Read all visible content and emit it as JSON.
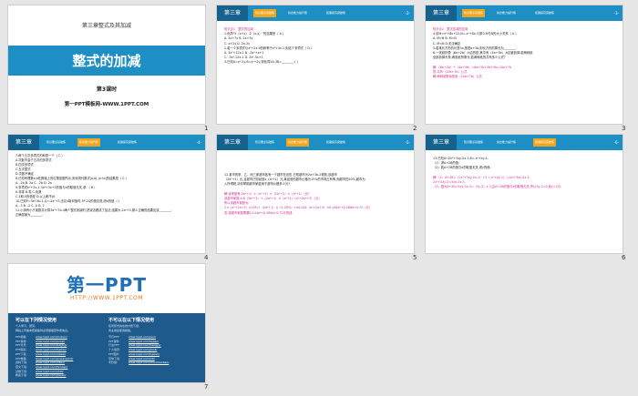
{
  "slides": [
    {
      "number": "1",
      "chapter": "第三章整式及其加减",
      "title": "整式的加减",
      "lesson": "第3课时",
      "site": "第一PPT模板网-WWW.1PPT.COM"
    },
    {
      "number": "2",
      "tag": "第三章",
      "tabs": [
        "知识要点基础练",
        "综合能力提升练",
        "拓展探究突破练"
      ],
      "active_tab": 0,
      "page": "-2-",
      "lines": [
        "知识点1　整式的加减",
        "1.化简\"5（x+y）-2（x-y）\"的结果是（ A ）",
        "A. 3x+7y  B. 2x+3y",
        "C. x+2y  D. 2x-2y",
        "2.若一个多项式与x²+2x-9的和等于x²+4x-1,则这个多项式（ D ）",
        "A. 3x²+12x-1  B. -3x²+x+1",
        "C. -3x²-12x-1  D. 2x²-5x+1",
        "3.已知A=x²-2y,B=y²+2y,则化简2A-3B=________.( )"
      ]
    },
    {
      "number": "3",
      "tag": "第三章",
      "tabs": [
        "知识要点基础练",
        "综合能力提升练",
        "拓展探究突破练"
      ],
      "active_tab": 0,
      "page": "-3-",
      "lines": [
        "知识点2　整式加减的应用",
        "4.设M=x²+8x+12,N=-x²+8x-3,那么M与N的大小关系（ A ）",
        "A. M>N  B. M=N",
        "C. M<N  D.无法确定",
        "5.若某长方形的长是3a,宽是a+2b,则长方形的周长为________.",
        "6.一张纸折叠（6a+2b）,b边的是,其中有（4a+5b）,b边被剪掉,若两种纸",
        "全部剪掉长条,两张纸所剩长,若两种纸的共有多少公式?",
        "",
        "解:（6a+2b）+（4a+5b）=6a+2b+4a+5b=10a+7b",
        "答:共有（10a+7b）公式.",
        "解:两种纸剩余的纸（10a+7b）公式."
      ]
    },
    {
      "number": "4",
      "tag": "第三章",
      "tabs": [
        "知识要点基础练",
        "综合能力提升练",
        "拓展探究突破练"
      ],
      "active_tab": 1,
      "page": "-4-",
      "lines": [
        "7.两个五次多项式的和是一个（ C ）",
        "A.次数不高于五次的多项式",
        "B.四次多项式",
        "C.五次整式",
        "D.次数不确定",
        "8.已知有理数a,b在数轴上的位置如图所示,则化简代数式|a-b|-|a+b|的结果是（ C ）",
        "A. -2b  B. 2a  C. -2b  D. 2a",
        "9.多项式x²+2x-1-3x²+3x+2的值与x的取值无关,求-（ B ）",
        "A.非零  B.零  C.负数",
        "C.2和-5的值是 D.以上都不对",
        "10.已知P=3a²-5b-1,Q=-2a²+3,无论x取何值时,3P-2Q的值总是,则a的值（ ）",
        "A. -3  B. -2  C. 0  D. 2",
        "11.小淇有小于某数并计算3a²+7b-4两个整式相减时,把减法看成了加法,结果为-2a²+5,那么正确的结果应该________.",
        "正确答案为________."
      ]
    },
    {
      "number": "5",
      "tag": "第三章",
      "tabs": [
        "知识要点基础练",
        "综合能力提升练",
        "拓展探究突破练"
      ],
      "active_tab": 1,
      "page": "-5-",
      "lines": [
        "12.某市的甲、乙、丙三家超市各有一个超市在出售,已知超市为2a+3b-2得到,该超市",
        "（2a²+1）元,且超市已知经营x（a²+1）元,某经营的超市价格为15%的市场占有率,而超市的20%,超市为",
        "入所得税,请你帮助超市家庭用于超市价格多少元?",
        "",
        "解:该家庭有:2a²+1）×（a²+1）×（2a²+2）×（a²+1）（元）",
        "该超市家庭:0.6（3a²+2）+（2a²+1）×（a²+1）（a²+2a²+3）（元）",
        "所以该超市家庭为:",
        "2.x（a²+2a+3）×15%+（2a²+1）×（1-20%）+x0.144（a²+2a+3）×0.144a²+0.288a+0.72（元）",
        "答:该超市家庭需要0.144a²+0.288a+0.72元的钱."
      ]
    },
    {
      "number": "6",
      "tag": "第三章",
      "tabs": [
        "知识要点基础练",
        "综合能力提升练",
        "拓展探究突破练"
      ],
      "active_tab": 2,
      "page": "-6-",
      "lines": [
        "13.已知A=2x²+3xy-2x-1,B=-x²+xy-1.",
        "（1）求A+2B的值;",
        "（2）若A+2B的值与x的取值无关,求y的值.",
        "",
        "解:（1）A+2B=（2x²+3xy-2x-1）+2（-x²+xy-1）=2x²+3xy-2x-1-",
        "2x²+2xy-2=5xy-2x-3.",
        "（2）因为A+2B=5xy-2x-3=（5y-2）x-3,且A+2B的值与x的取值无关,所以5y-2=0,则y=2/5."
      ]
    },
    {
      "number": "7",
      "logo": "第一PPT",
      "url": "HTTP://WWW.1PPT.COM",
      "can_use": "可以在下列情况使用",
      "can_use_items": [
        "个人学习、研究;",
        "网站上传播本套模板时必须保留原作者信息。"
      ],
      "cannot_use": "不可以在以下情况使用",
      "cannot_use_items": [
        "任何形式的在线付费下载;",
        "商业用途使用模板。"
      ],
      "links_left": [
        [
          "PPT模板:",
          "www.1ppt.com/moban/"
        ],
        [
          "PPT素材:",
          "www.1ppt.com/sucai/"
        ],
        [
          "PPT背景:",
          "www.1ppt.com/beijing/"
        ],
        [
          "PPT图表:",
          "www.1ppt.com/tubiao/"
        ],
        [
          "PPT下载:",
          "www.1ppt.com/xiazai/"
        ],
        [
          "PPT教程:",
          "www.1ppt.com/powerpoint/"
        ],
        [
          "资料下载:",
          "www.1ppt.com/ziliao/"
        ],
        [
          "范文下载:",
          "www.1ppt.com/fanwen/"
        ],
        [
          "试卷下载:",
          "www.1ppt.com/shiti/"
        ],
        [
          "教案下载:",
          "www.1ppt.com/jiaoan/"
        ]
      ],
      "links_right": [
        [
          "节日PPT:",
          "www.1ppt.com/jieri/"
        ],
        [
          "PPT课件:",
          "www.1ppt.com/kejian/"
        ],
        [
          "行业PPT:",
          "www.1ppt.com/hangye/"
        ],
        [
          "个人简历:",
          "www.1ppt.com/jianli/"
        ],
        [
          "PPT图片:",
          "www.1ppt.com/tupian/"
        ],
        [
          "字体下载:",
          "www.1ppt.com/ziti/"
        ],
        [
          "手抄报:",
          "www.1ppt.com/shouchaobao/"
        ]
      ]
    }
  ],
  "colors": {
    "header": "#1e8fc4",
    "header_dark": "#16628e",
    "active_tab": "#f2a51a",
    "title_band": "#1e8fc4"
  }
}
